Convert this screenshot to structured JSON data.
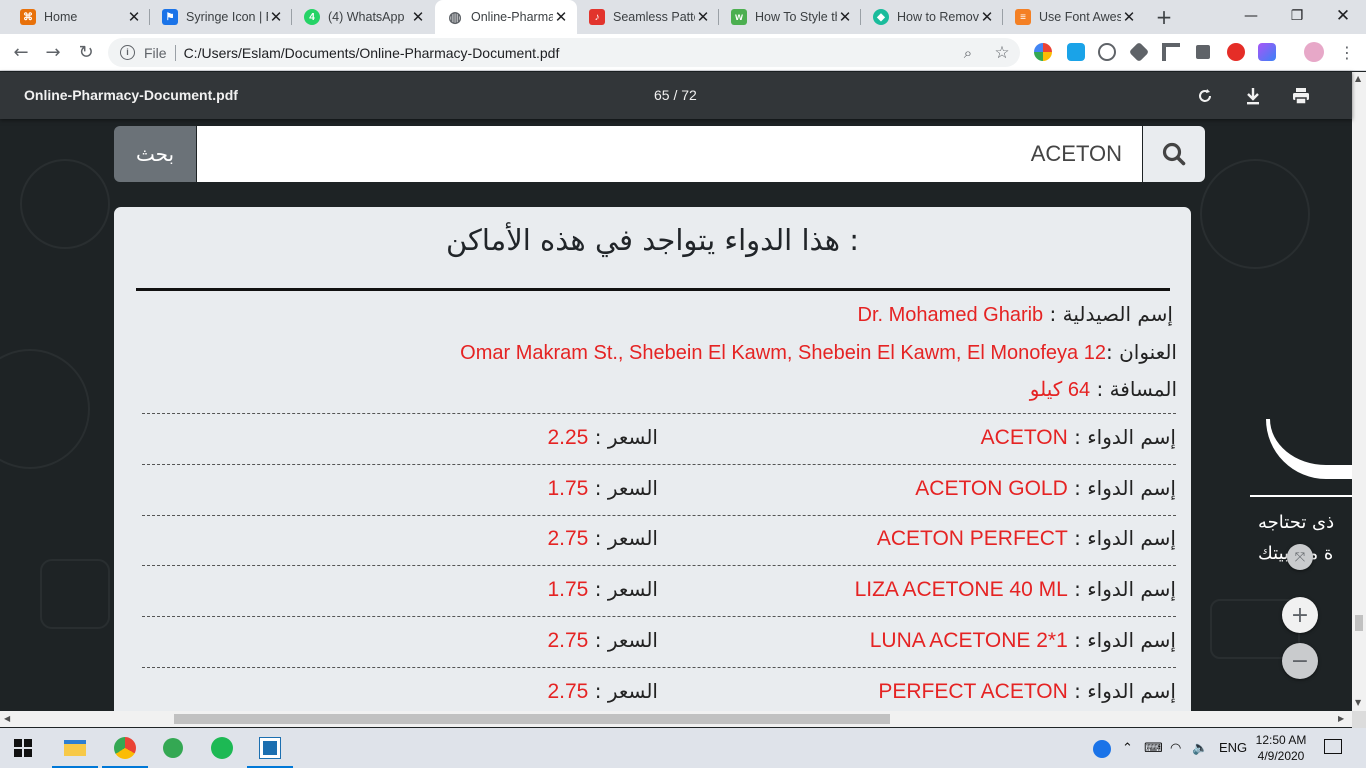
{
  "tabs": [
    {
      "title": "Home",
      "fav_color": "#e8710a",
      "fav_glyph": "⌘",
      "active": false
    },
    {
      "title": "Syringe Icon | F",
      "fav_color": "#1a73e8",
      "fav_glyph": "⚑",
      "active": false
    },
    {
      "title": "(4) WhatsApp",
      "fav_color": "#25d366",
      "fav_glyph": "4",
      "active": false
    },
    {
      "title": "Online-Pharma",
      "fav_color": "#5f6368",
      "fav_glyph": "◍",
      "active": true
    },
    {
      "title": "Seamless Patte",
      "fav_color": "#e2342d",
      "fav_glyph": "♪",
      "active": false
    },
    {
      "title": "How To Style th",
      "fav_color": "#4caf50",
      "fav_glyph": "w",
      "active": false
    },
    {
      "title": "How to Remov",
      "fav_color": "#1abc9c",
      "fav_glyph": "◆",
      "active": false
    },
    {
      "title": "Use Font Awes",
      "fav_color": "#f48024",
      "fav_glyph": "≡",
      "active": false
    }
  ],
  "address": {
    "scheme_label": "File",
    "url": "C:/Users/Eslam/Documents/Online-Pharmacy-Document.pdf"
  },
  "pdf_toolbar": {
    "filename": "Online-Pharmacy-Document.pdf",
    "page_indicator": "65 / 72"
  },
  "search": {
    "button_label": "بحث",
    "query": "ACETON"
  },
  "results": {
    "heading": "هذا الدواء يتواجد في هذه الأماكن :",
    "pharmacy_label": "إسم الصيدلية :",
    "pharmacy_name": "Dr. Mohamed Gharib",
    "address_label": "العنوان :",
    "address_value": "Omar Makram St., Shebein El Kawm, Shebein El Kawm, El Monofeya 12",
    "distance_label": "المسافة :",
    "distance_value": "64 كيلو",
    "drug_label": "إسم الدواء :",
    "price_label": "السعر :",
    "drugs": [
      {
        "name": "ACETON",
        "price": "2.25"
      },
      {
        "name": "ACETON GOLD",
        "price": "1.75"
      },
      {
        "name": "ACETON PERFECT",
        "price": "2.75"
      },
      {
        "name": "LIZA ACETONE 40 ML",
        "price": "1.75"
      },
      {
        "name": "LUNA ACETONE 2*1",
        "price": "2.75"
      },
      {
        "name": "PERFECT ACETON",
        "price": "2.75"
      }
    ]
  },
  "side_slide": {
    "line1": "ذى تحتاجه",
    "line2": "ة من بيتك"
  },
  "taskbar": {
    "lang": "ENG",
    "time": "12:50 AM",
    "date": "4/9/2020"
  },
  "colors": {
    "accent_red": "#e52323",
    "pdf_toolbar": "#323639",
    "card_bg": "#e9ecef",
    "search_button": "#6b7278"
  }
}
